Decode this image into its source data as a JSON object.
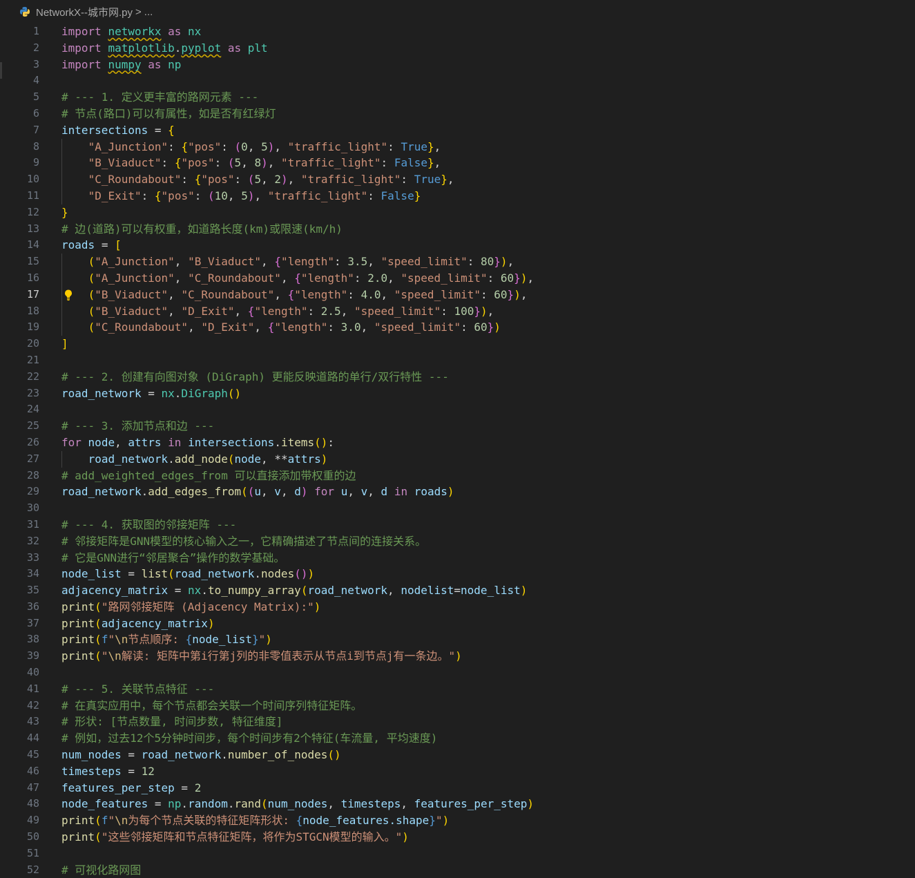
{
  "breadcrumb": {
    "file_name": "NetworkX--城市网.py",
    "separator": ">",
    "more": "..."
  },
  "editor": {
    "active_line": 17,
    "colors": {
      "background": "#1f1f1f",
      "keyword": "#c586c0",
      "string": "#ce9178",
      "comment": "#6a9955",
      "function": "#dcdcaa"
    },
    "lines": [
      "import networkx as nx",
      "import matplotlib.pyplot as plt",
      "import numpy as np",
      "",
      "# --- 1. 定义更丰富的路网元素 ---",
      "# 节点(路口)可以有属性，如是否有红绿灯",
      "intersections = {",
      "    \"A_Junction\": {\"pos\": (0, 5), \"traffic_light\": True},",
      "    \"B_Viaduct\": {\"pos\": (5, 8), \"traffic_light\": False},",
      "    \"C_Roundabout\": {\"pos\": (5, 2), \"traffic_light\": True},",
      "    \"D_Exit\": {\"pos\": (10, 5), \"traffic_light\": False}",
      "}",
      "# 边(道路)可以有权重，如道路长度(km)或限速(km/h)",
      "roads = [",
      "    (\"A_Junction\", \"B_Viaduct\", {\"length\": 3.5, \"speed_limit\": 80}),",
      "    (\"A_Junction\", \"C_Roundabout\", {\"length\": 2.0, \"speed_limit\": 60}),",
      "    (\"B_Viaduct\", \"C_Roundabout\", {\"length\": 4.0, \"speed_limit\": 60}),",
      "    (\"B_Viaduct\", \"D_Exit\", {\"length\": 2.5, \"speed_limit\": 100}),",
      "    (\"C_Roundabout\", \"D_Exit\", {\"length\": 3.0, \"speed_limit\": 60})",
      "]",
      "",
      "# --- 2. 创建有向图对象 (DiGraph) 更能反映道路的单行/双行特性 ---",
      "road_network = nx.DiGraph()",
      "",
      "# --- 3. 添加节点和边 ---",
      "for node, attrs in intersections.items():",
      "    road_network.add_node(node, **attrs)",
      "# add_weighted_edges_from 可以直接添加带权重的边",
      "road_network.add_edges_from((u, v, d) for u, v, d in roads)",
      "",
      "# --- 4. 获取图的邻接矩阵 ---",
      "# 邻接矩阵是GNN模型的核心输入之一，它精确描述了节点间的连接关系。",
      "# 它是GNN进行“邻居聚合”操作的数学基础。",
      "node_list = list(road_network.nodes())",
      "adjacency_matrix = nx.to_numpy_array(road_network, nodelist=node_list)",
      "print(\"路网邻接矩阵 (Adjacency Matrix):\")",
      "print(adjacency_matrix)",
      "print(f\"\\n节点顺序: {node_list}\")",
      "print(\"\\n解读: 矩阵中第i行第j列的非零值表示从节点i到节点j有一条边。\")",
      "",
      "# --- 5. 关联节点特征 ---",
      "# 在真实应用中，每个节点都会关联一个时间序列特征矩阵。",
      "# 形状: [节点数量, 时间步数, 特征维度]",
      "# 例如，过去12个5分钟时间步，每个时间步有2个特征(车流量, 平均速度)",
      "num_nodes = road_network.number_of_nodes()",
      "timesteps = 12",
      "features_per_step = 2",
      "node_features = np.random.rand(num_nodes, timesteps, features_per_step)",
      "print(f\"\\n为每个节点关联的特征矩阵形状: {node_features.shape}\")",
      "print(\"这些邻接矩阵和节点特征矩阵，将作为STGCN模型的输入。\")",
      "",
      "# 可视化路网图"
    ]
  }
}
